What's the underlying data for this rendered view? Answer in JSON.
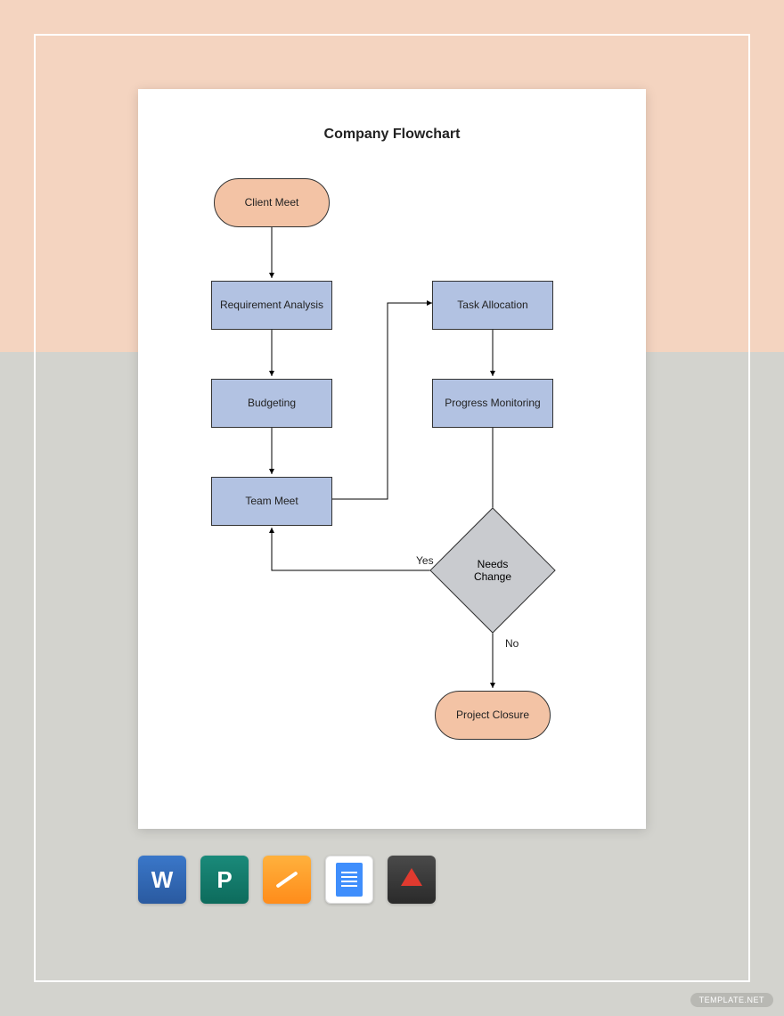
{
  "title": "Company Flowchart",
  "nodes": {
    "client_meet": "Client Meet",
    "requirement_analysis": "Requirement Analysis",
    "budgeting": "Budgeting",
    "team_meet": "Team Meet",
    "task_allocation": "Task Allocation",
    "progress_monitoring": "Progress Monitoring",
    "needs_change": "Needs Change",
    "project_closure": "Project Closure"
  },
  "edges": {
    "yes": "Yes",
    "no": "No"
  },
  "colors": {
    "terminator": "#f3c3a5",
    "process": "#b2c2e2",
    "decision": "#c9cbcf",
    "bg_top": "#f4d4c0",
    "bg_bottom": "#d3d3ce"
  },
  "icons": {
    "word": "Word",
    "publisher": "Publisher",
    "pages": "Pages",
    "gdocs": "Google Docs",
    "pdf": "PDF"
  },
  "watermark": "TEMPLATE.NET"
}
